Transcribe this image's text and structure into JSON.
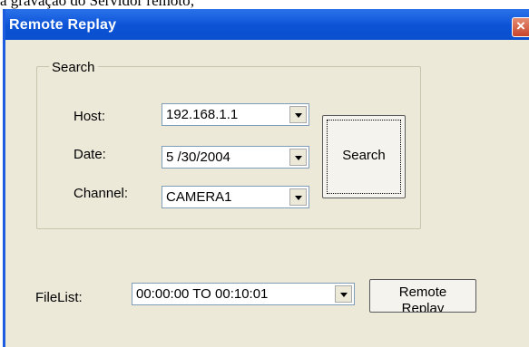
{
  "caption": "a gravação do Servidor remoto;",
  "window": {
    "title": "Remote Replay",
    "close_glyph": "×"
  },
  "search_group": {
    "label": "Search",
    "host": {
      "label": "Host:",
      "value": "192.168.1.1"
    },
    "date": {
      "label": "Date:",
      "value": "5 /30/2004"
    },
    "channel": {
      "label": "Channel:",
      "value": "CAMERA1"
    },
    "search_button": "Search"
  },
  "filelist": {
    "label": "FileList:",
    "value": "00:00:00 TO 00:10:01",
    "remote_button_line1": "Remote",
    "remote_button_line2": "Replay"
  },
  "colors": {
    "titlebar": "#0b53d6",
    "window_bg": "#ece9d8"
  },
  "icons": {
    "close": "close-icon",
    "dropdown": "chevron-down-icon"
  }
}
